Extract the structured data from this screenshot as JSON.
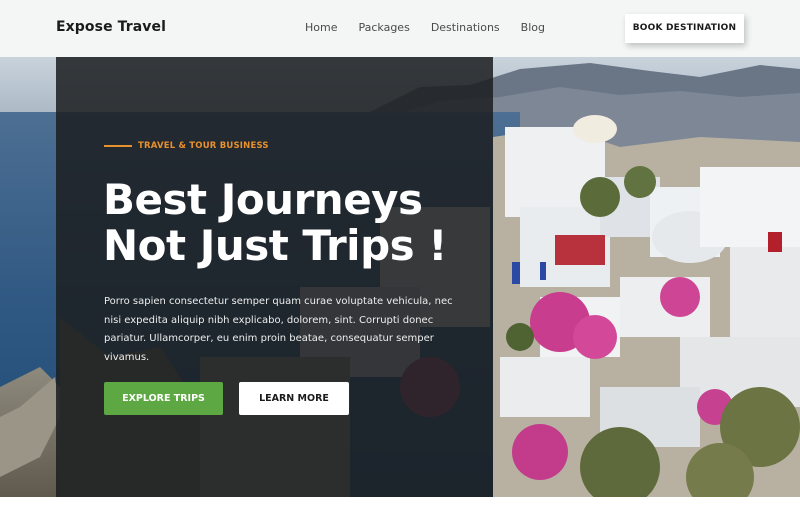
{
  "header": {
    "brand": "Expose Travel",
    "nav": [
      "Home",
      "Packages",
      "Destinations",
      "Blog"
    ],
    "cta_label": "BOOK DESTINATION"
  },
  "hero": {
    "eyebrow": "TRAVEL & TOUR BUSINESS",
    "headline_line1": "Best Journeys",
    "headline_line2": "Not Just Trips !",
    "description": "Porro sapien consectetur semper quam curae voluptate vehicula, nec nisi expedita aliquip nibh explicabo, dolorem, sint. Corrupti donec pariatur. Ullamcorper, eu enim proin beatae, consequatur semper vivamus.",
    "primary_button": "EXPLORE TRIPS",
    "secondary_button": "LEARN MORE",
    "background_image": "santorini-coastline-photo"
  },
  "colors": {
    "accent_orange": "#e8912d",
    "primary_green": "#5da843",
    "panel_dark": "#1c1e21",
    "header_bg": "#f4f6f5"
  }
}
